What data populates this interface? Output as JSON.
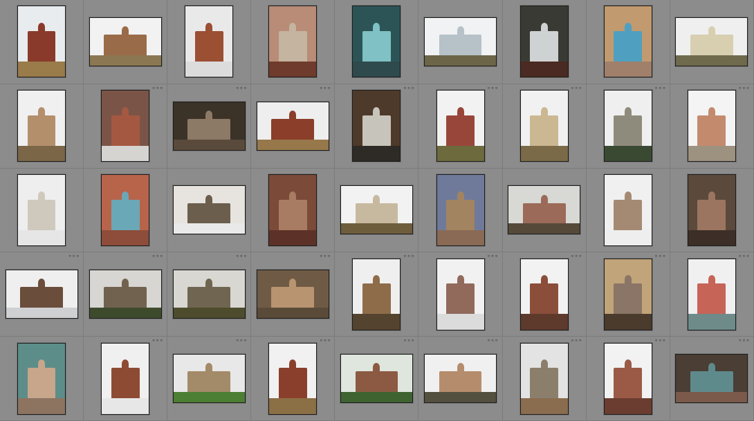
{
  "grid": {
    "columns": 9,
    "rows": 5,
    "items": [
      {
        "o": "p",
        "sky": "#e8ecef",
        "ground": "#9a7b4a",
        "mid": "#8a3a2a",
        "dots": false
      },
      {
        "o": "l",
        "sky": "#f2f2f2",
        "ground": "#8b7752",
        "mid": "#9a6b48",
        "dots": false
      },
      {
        "o": "p",
        "sky": "#e9e9ea",
        "ground": "#dcdcdc",
        "mid": "#9b4f33",
        "dots": false
      },
      {
        "o": "p",
        "sky": "#b88c76",
        "ground": "#6f3b2c",
        "mid": "#c4b4a0",
        "dots": false
      },
      {
        "o": "p",
        "sky": "#2c5457",
        "ground": "#2e4a4c",
        "mid": "#7fc1c4",
        "dots": false
      },
      {
        "o": "l",
        "sky": "#f1f2f3",
        "ground": "#6c6547",
        "mid": "#b6c1c8",
        "dots": false
      },
      {
        "o": "p",
        "sky": "#3a3a34",
        "ground": "#4a2a22",
        "mid": "#cfd2d2",
        "dots": false
      },
      {
        "o": "p",
        "sky": "#c19a6f",
        "ground": "#a0806a",
        "mid": "#4fa0c0",
        "dots": false
      },
      {
        "o": "l",
        "sky": "#efefef",
        "ground": "#6f6a4c",
        "mid": "#d8cfb1",
        "dots": false
      },
      {
        "o": "p",
        "sky": "#f0f0f0",
        "ground": "#7c6648",
        "mid": "#b48f6c",
        "dots": false
      },
      {
        "o": "p",
        "sky": "#7a5547",
        "ground": "#d5d4d1",
        "mid": "#a55841",
        "dots": true
      },
      {
        "o": "l",
        "sky": "#3b3228",
        "ground": "#5a4a3c",
        "mid": "#8c7a66",
        "dots": true
      },
      {
        "o": "l",
        "sky": "#eeeeee",
        "ground": "#96784a",
        "mid": "#8b3e2a",
        "dots": true
      },
      {
        "o": "p",
        "sky": "#4e3a2a",
        "ground": "#2e2a26",
        "mid": "#c7c4bb",
        "dots": true
      },
      {
        "o": "p",
        "sky": "#f2f2f2",
        "ground": "#6d6a3e",
        "mid": "#99463a",
        "dots": true
      },
      {
        "o": "p",
        "sky": "#f1f1f1",
        "ground": "#7a6a47",
        "mid": "#cbb893",
        "dots": true
      },
      {
        "o": "p",
        "sky": "#efefef",
        "ground": "#3a4a32",
        "mid": "#8f8b7c",
        "dots": true
      },
      {
        "o": "p",
        "sky": "#f4f4f4",
        "ground": "#9d9280",
        "mid": "#c48a6e",
        "dots": true
      },
      {
        "o": "p",
        "sky": "#eeeeee",
        "ground": "#e6e6e6",
        "mid": "#cfc9bd",
        "dots": false
      },
      {
        "o": "p",
        "sky": "#b8644a",
        "ground": "#8d4d3a",
        "mid": "#6aa8b8",
        "dots": false
      },
      {
        "o": "l",
        "sky": "#e7e3de",
        "ground": "#e9e9e9",
        "mid": "#6b5e4c",
        "dots": false
      },
      {
        "o": "p",
        "sky": "#7c4a38",
        "ground": "#5c3228",
        "mid": "#a87b63",
        "dots": false
      },
      {
        "o": "l",
        "sky": "#f2f2f2",
        "ground": "#6e5d3d",
        "mid": "#c7b9a0",
        "dots": false
      },
      {
        "o": "p",
        "sky": "#6f7a9b",
        "ground": "#8a6a55",
        "mid": "#a28460",
        "dots": false
      },
      {
        "o": "l",
        "sky": "#d8d8d5",
        "ground": "#554a3a",
        "mid": "#9b6a58",
        "dots": false
      },
      {
        "o": "p",
        "sky": "#f0f0f0",
        "ground": "#eeeeee",
        "mid": "#a58a73",
        "dots": false
      },
      {
        "o": "p",
        "sky": "#5b4a3c",
        "ground": "#3d2f27",
        "mid": "#9c7560",
        "dots": false
      },
      {
        "o": "l",
        "sky": "#efefef",
        "ground": "#cfd0d2",
        "mid": "#6b4d3c",
        "dots": true
      },
      {
        "o": "l",
        "sky": "#d7d6d2",
        "ground": "#3e4a2c",
        "mid": "#71624f",
        "dots": true
      },
      {
        "o": "l",
        "sky": "#d9d7d2",
        "ground": "#4d4c2c",
        "mid": "#6f6550",
        "dots": true
      },
      {
        "o": "l",
        "sky": "#6f5b45",
        "ground": "#5a4a38",
        "mid": "#b99471",
        "dots": true
      },
      {
        "o": "p",
        "sky": "#efefef",
        "ground": "#54432e",
        "mid": "#8e6c49",
        "dots": true
      },
      {
        "o": "p",
        "sky": "#f1f1f1",
        "ground": "#dbdbdb",
        "mid": "#916a5c",
        "dots": true
      },
      {
        "o": "p",
        "sky": "#f2f2f2",
        "ground": "#5e3a2c",
        "mid": "#8a4e3a",
        "dots": true
      },
      {
        "o": "p",
        "sky": "#c1a47a",
        "ground": "#4a3b2d",
        "mid": "#8a7566",
        "dots": true
      },
      {
        "o": "p",
        "sky": "#f0f0f0",
        "ground": "#6e8b8a",
        "mid": "#c66458",
        "dots": true
      },
      {
        "o": "p",
        "sky": "#5c8d89",
        "ground": "#8c7461",
        "mid": "#c7a68b",
        "dots": false
      },
      {
        "o": "p",
        "sky": "#f0f0f0",
        "ground": "#e7e7e7",
        "mid": "#8e4b34",
        "dots": true
      },
      {
        "o": "l",
        "sky": "#e8e8e8",
        "ground": "#4c7f33",
        "mid": "#a38a68",
        "dots": true
      },
      {
        "o": "p",
        "sky": "#f1f1f1",
        "ground": "#8b6f45",
        "mid": "#8a3f2c",
        "dots": true
      },
      {
        "o": "l",
        "sky": "#dfe6de",
        "ground": "#3e6330",
        "mid": "#8c5a42",
        "dots": true
      },
      {
        "o": "l",
        "sky": "#f0f0f0",
        "ground": "#54503f",
        "mid": "#b58d6d",
        "dots": true
      },
      {
        "o": "p",
        "sky": "#e3e3e3",
        "ground": "#8a6d4e",
        "mid": "#8b7f6c",
        "dots": true
      },
      {
        "o": "p",
        "sky": "#f2f2f2",
        "ground": "#6a3d30",
        "mid": "#9a5a46",
        "dots": true
      },
      {
        "o": "l",
        "sky": "#4a3e35",
        "ground": "#7c5a4b",
        "mid": "#5f8a8c",
        "dots": true
      }
    ]
  }
}
